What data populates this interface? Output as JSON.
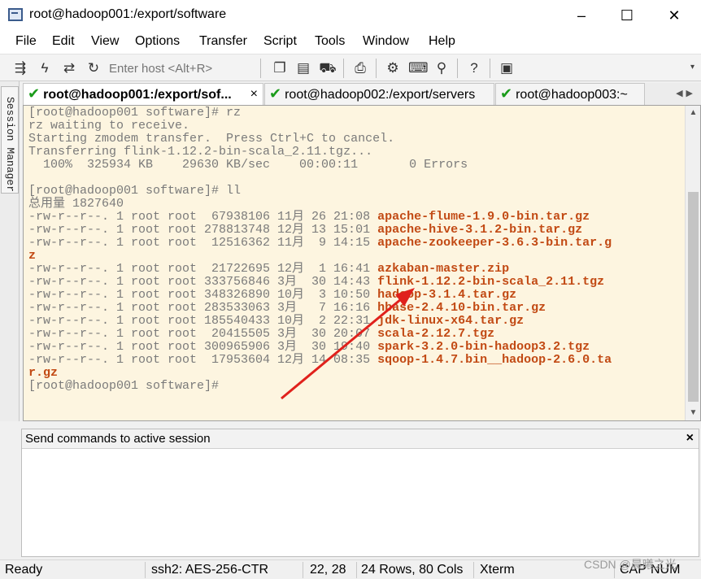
{
  "window": {
    "title": "root@hadoop001:/export/software",
    "minimize": "–",
    "maximize": "☐",
    "close": "✕"
  },
  "menu": [
    "File",
    "Edit",
    "View",
    "Options",
    "Transfer",
    "Script",
    "Tools",
    "Window",
    "Help"
  ],
  "toolbar": {
    "host_placeholder": "Enter host <Alt+R>",
    "icons": [
      "connect-icon",
      "quick-connect-icon",
      "reconnect-icon",
      "disconnect-icon",
      "copy-icon",
      "paste-icon",
      "find-icon",
      "print-icon",
      "settings-icon",
      "keymap-icon",
      "sftp-icon",
      "help-icon",
      "screen-icon"
    ]
  },
  "sidebar": {
    "label": "Session Manager"
  },
  "tabs": [
    {
      "label": "root@hadoop001:/export/sof...",
      "active": true,
      "close": "×"
    },
    {
      "label": "root@hadoop002:/export/servers",
      "active": false
    },
    {
      "label": "root@hadoop003:~",
      "active": false
    }
  ],
  "terminal": {
    "lines": [
      {
        "text": "[root@hadoop001 software]# rz"
      },
      {
        "text": "rz waiting to receive."
      },
      {
        "text": "Starting zmodem transfer.  Press Ctrl+C to cancel."
      },
      {
        "text": "Transferring flink-1.12.2-bin-scala_2.11.tgz..."
      },
      {
        "text": "  100%  325934 KB    29630 KB/sec    00:00:11       0 Errors"
      },
      {
        "text": ""
      },
      {
        "text": "[root@hadoop001 software]# ll"
      },
      {
        "text": "总用量 1827640"
      },
      {
        "text": "-rw-r--r--. 1 root root  67938106 11月 26 21:08 ",
        "file": "apache-flume-1.9.0-bin.tar.gz"
      },
      {
        "text": "-rw-r--r--. 1 root root 278813748 12月 13 15:01 ",
        "file": "apache-hive-3.1.2-bin.tar.gz"
      },
      {
        "text": "-rw-r--r--. 1 root root  12516362 11月  9 14:15 ",
        "file": "apache-zookeeper-3.6.3-bin.tar.g"
      },
      {
        "text": "",
        "file": "z"
      },
      {
        "text": "-rw-r--r--. 1 root root  21722695 12月  1 16:41 ",
        "file": "azkaban-master.zip"
      },
      {
        "text": "-rw-r--r--. 1 root root 333756846 3月  30 14:43 ",
        "file": "flink-1.12.2-bin-scala_2.11.tgz"
      },
      {
        "text": "-rw-r--r--. 1 root root 348326890 10月  3 10:50 ",
        "file": "hadoop-3.1.4.tar.gz"
      },
      {
        "text": "-rw-r--r--. 1 root root 283533063 3月   7 16:16 ",
        "file": "hbase-2.4.10-bin.tar.gz"
      },
      {
        "text": "-rw-r--r--. 1 root root 185540433 10月  2 22:31 ",
        "file": "jdk-linux-x64.tar.gz"
      },
      {
        "text": "-rw-r--r--. 1 root root  20415505 3月  30 20:07 ",
        "file": "scala-2.12.7.tgz"
      },
      {
        "text": "-rw-r--r--. 1 root root 300965906 3月  30 19:40 ",
        "file": "spark-3.2.0-bin-hadoop3.2.tgz"
      },
      {
        "text": "-rw-r--r--. 1 root root  17953604 12月 14 08:35 ",
        "file": "sqoop-1.4.7.bin__hadoop-2.6.0.ta"
      },
      {
        "text": "",
        "file": "r.gz"
      },
      {
        "text": "[root@hadoop001 software]#"
      }
    ]
  },
  "command_panel": {
    "title": "Send commands to active session",
    "close": "×"
  },
  "status": {
    "ready": "Ready",
    "cipher": "ssh2: AES-256-CTR",
    "cursor": "22,  28",
    "size": "24 Rows, 80 Cols",
    "term": "Xterm",
    "caps": "CAP",
    "num": "NUM"
  },
  "watermark": "CSDN @晨曦之光",
  "colors": {
    "terminal_bg": "#fdf5e0",
    "filename": "#c24a14",
    "arrow": "#e0211c",
    "check": "#1a9b1a"
  }
}
